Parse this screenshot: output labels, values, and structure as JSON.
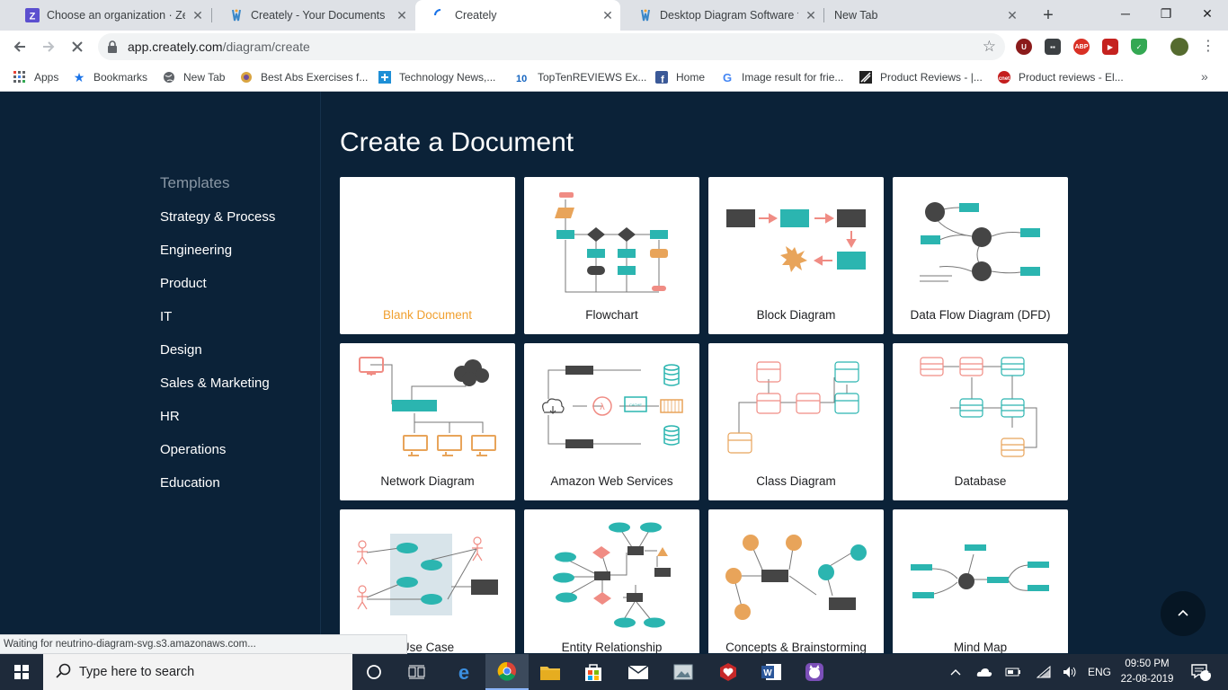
{
  "browser": {
    "tabs": [
      {
        "title": "Choose an organization · ZenH",
        "icon": "zenhub-icon"
      },
      {
        "title": "Creately - Your Documents",
        "icon": "creately-icon"
      },
      {
        "title": "Creately",
        "icon": "loading-spinner-icon"
      },
      {
        "title": "Desktop Diagram Software for",
        "icon": "creately-icon"
      },
      {
        "title": "New Tab",
        "icon": ""
      }
    ],
    "new_tab": "+",
    "window_controls": {
      "minimize": "─",
      "maximize": "❐",
      "close": "✕"
    },
    "url_host": "app.creately.com",
    "url_path": "/diagram/create",
    "extensions": [
      "U",
      "▪▪",
      "ABP",
      "▶",
      "✓"
    ],
    "bookmarks": [
      {
        "label": "Apps"
      },
      {
        "label": "Bookmarks"
      },
      {
        "label": "New Tab"
      },
      {
        "label": "Best Abs Exercises f..."
      },
      {
        "label": "Technology News,..."
      },
      {
        "label": "TopTenREVIEWS Ex..."
      },
      {
        "label": "Home"
      },
      {
        "label": "Image result for frie..."
      },
      {
        "label": "Product Reviews - |..."
      },
      {
        "label": "Product reviews - El..."
      }
    ],
    "status_text": "Waiting for neutrino-diagram-svg.s3.amazonaws.com..."
  },
  "page": {
    "title": "Create a Document",
    "sidebar": {
      "heading": "Templates",
      "categories": [
        "Strategy & Process",
        "Engineering",
        "Product",
        "IT",
        "Design",
        "Sales & Marketing",
        "HR",
        "Operations",
        "Education"
      ]
    },
    "cards": [
      {
        "label": "Blank Document"
      },
      {
        "label": "Flowchart"
      },
      {
        "label": "Block Diagram"
      },
      {
        "label": "Data Flow Diagram (DFD)"
      },
      {
        "label": "Network Diagram"
      },
      {
        "label": "Amazon Web Services"
      },
      {
        "label": "Class Diagram"
      },
      {
        "label": "Database"
      },
      {
        "label": "Use Case"
      },
      {
        "label": "Entity Relationship"
      },
      {
        "label": "Concepts & Brainstorming"
      },
      {
        "label": "Mind Map"
      }
    ],
    "scroll_top_icon": "chevron-up-icon",
    "colors": {
      "teal": "#2bb5b0",
      "dark": "#454545",
      "salmon": "#f08c84",
      "orange": "#e8a45a",
      "bg": "#0b2238"
    }
  },
  "taskbar": {
    "search_placeholder": "Type here to search",
    "language": "ENG",
    "time": "09:50 PM",
    "date": "22-08-2019",
    "notifications": "5"
  }
}
